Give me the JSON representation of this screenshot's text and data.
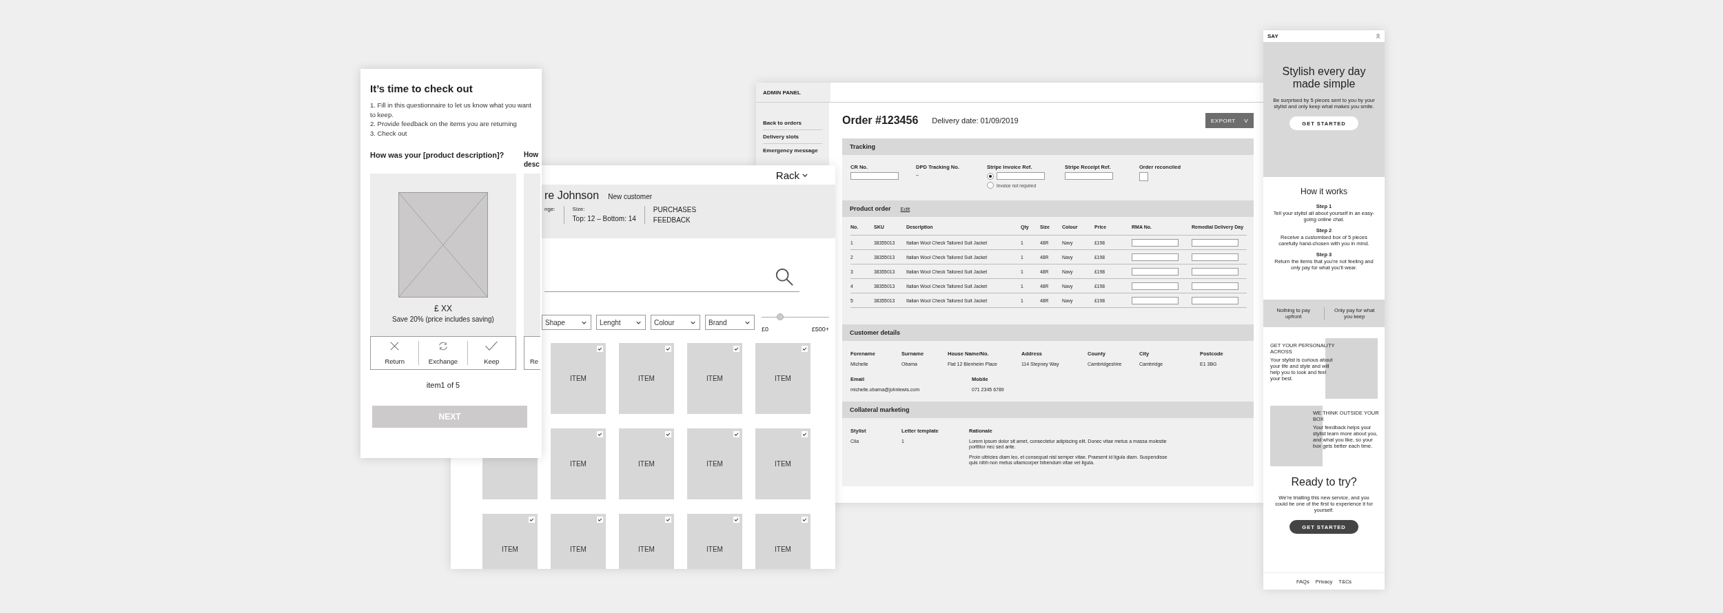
{
  "checkout_screen": {
    "title": "It’s time to check out",
    "steps": [
      "1. Fill in this questionnaire to let us know what you want to keep.",
      "2. Provide feedback on the items you are returning",
      "3. Check out"
    ],
    "questions": [
      {
        "heading": "How was your [product description]?",
        "price": "£ XX",
        "saving": "Save 20% (price includes saving)",
        "actions": [
          {
            "kind": "return",
            "label": "Return"
          },
          {
            "kind": "exchange",
            "label": "Exchange"
          },
          {
            "kind": "keep",
            "label": "Keep"
          }
        ]
      },
      {
        "heading": "How desc",
        "actions": [
          {
            "kind": "return",
            "label": "Re"
          }
        ]
      }
    ],
    "pager": "item1 of 5",
    "next_button": {
      "label": "NEXT",
      "disabled": true
    }
  },
  "rack_screen": {
    "menu": "Rack",
    "customer_name": "re Johnson",
    "customer_type": "New customer",
    "range_label": "nge:",
    "size_label": "Size:",
    "size_value": "Top: 12  –  Bottom: 14",
    "links": [
      "PURCHASES",
      "FEEDBACK"
    ],
    "filters": [
      {
        "label": "Shape"
      },
      {
        "label": "Lenght"
      },
      {
        "label": "Colour"
      },
      {
        "label": "Brand"
      }
    ],
    "price_range": {
      "min": "£0",
      "max": "£500+",
      "level": 0.28
    },
    "item_rows": [
      [
        {
          "label": "ITEM",
          "checked": true
        },
        {
          "label": "ITEM",
          "checked": true
        },
        {
          "label": "ITEM",
          "checked": true
        },
        {
          "label": "ITEM",
          "checked": true
        }
      ],
      [
        {
          "label": "ITEM",
          "checked": true
        },
        {
          "label": "ITEM",
          "checked": true
        },
        {
          "label": "ITEM",
          "checked": true
        },
        {
          "label": "ITEM",
          "checked": true
        }
      ],
      [
        {
          "label": "ITEM",
          "checked": true
        },
        {
          "label": "ITEM",
          "checked": true
        },
        {
          "label": "ITEM",
          "checked": true
        },
        {
          "label": "ITEM",
          "checked": true
        },
        {
          "label": "ITEM",
          "checked": true
        }
      ]
    ]
  },
  "admin_screen": {
    "brand": "ADMIN PANEL",
    "nav": [
      {
        "label": "Back to orders"
      },
      {
        "label": "Delivery slots"
      },
      {
        "label": "Emergency message"
      }
    ],
    "order_title": "Order #123456",
    "delivery_date": "Delivery date: 01/09/2019",
    "export_button": {
      "label": "EXPORT",
      "caret": "V"
    },
    "tracking": {
      "title": "Tracking",
      "cr_label": "CR No.",
      "dpd_label": "DPD Tracking No.",
      "dpd_value": "–",
      "invoice_label": "Stripe Invoice Ref.",
      "invoice_options": [
        {
          "kind": "input",
          "selected": true
        },
        {
          "kind": "text",
          "label": "Invoice not required",
          "selected": false
        }
      ],
      "receipt_label": "Stripe Receipt Ref.",
      "reconciled_label": "Order reconciled",
      "reconciled": false
    },
    "product_order": {
      "title": "Product order",
      "edit_link": "Edit",
      "columns": [
        "No.",
        "SKU",
        "Description",
        "Qty",
        "Size",
        "Colour",
        "Price",
        "RMA No.",
        "Remedial Delivery Day"
      ],
      "rows": [
        [
          "1",
          "38355013",
          "Italian Wool Check Tailored Suit Jacket",
          "1",
          "48R",
          "Navy",
          "£198"
        ],
        [
          "2",
          "38355013",
          "Italian Wool Check Tailored Suit Jacket",
          "1",
          "48R",
          "Navy",
          "£198"
        ],
        [
          "3",
          "38355013",
          "Italian Wool Check Tailored Suit Jacket",
          "1",
          "48R",
          "Navy",
          "£198"
        ],
        [
          "4",
          "38355013",
          "Italian Wool Check Tailored Suit Jacket",
          "1",
          "48R",
          "Navy",
          "£198"
        ],
        [
          "5",
          "38355013",
          "Italian Wool Check Tailored Suit Jacket",
          "1",
          "48R",
          "Navy",
          "£198"
        ]
      ]
    },
    "customer": {
      "title": "Customer details",
      "fields": [
        {
          "label": "Forename",
          "value": "Michelle"
        },
        {
          "label": "Surname",
          "value": "Obama"
        },
        {
          "label": "House Name/No.",
          "value": "Flat 12 Blenheim Place"
        },
        {
          "label": "Address",
          "value": "114 Stepney Way"
        },
        {
          "label": "County",
          "value": "Cambridgeshire"
        },
        {
          "label": "City",
          "value": "Cambridge"
        },
        {
          "label": "Postcode",
          "value": "E1 3BG"
        }
      ],
      "contacts": [
        {
          "label": "Email",
          "value": "michelle.obama@johnlewis.com"
        },
        {
          "label": "Mobile",
          "value": "071 2345 6789"
        }
      ]
    },
    "marketing": {
      "title": "Collateral marketing",
      "stylist_label": "Stylist",
      "stylist": "Cila",
      "template_label": "Letter template",
      "template": "1",
      "rationale_label": "Rationale",
      "rationale": [
        "Lorem ipsum dolor sit amet, consectetur adipiscing elit. Donec vitae metus a massa molestie porttitor nec sed ante.",
        "Proin ultricies diam leo, et consequat nisl semper vitae. Praesent id ligula diam. Suspendisse quis nibh non metus ullamcorper bibendum vitae vel ligula."
      ]
    }
  },
  "mobile_screen": {
    "logo": "SAY",
    "hero_title": "Stylish every day made simple",
    "hero_text": "Be surprised by 5 pieces sent to you by your stylist and only keep what makes you smile.",
    "hero_button": "GET STARTED",
    "how_title": "How it works",
    "steps": [
      {
        "title": "Step 1",
        "text": "Tell your stylist all about yourself in an easy-going online chat."
      },
      {
        "title": "Step 2",
        "text": "Receive a customised box of 5 pieces carefully hand-chosen with you in mind."
      },
      {
        "title": "Step 3",
        "text": "Return the items that you’re not feeling and only pay for what you’ll wear."
      }
    ],
    "perks": [
      "Nothing to pay upfront",
      "Only pay for what you keep"
    ],
    "features": [
      {
        "kind": "image_right",
        "title": "GET YOUR PERSONALITY ACROSS",
        "text": "Your stylist is curious about your life and style and will help you to look and feel your best."
      },
      {
        "kind": "image_left",
        "title": "WE THINK OUTSIDE YOUR BOX",
        "text": "Your feedback helps your stylist learn more about you, and what you like, so your box gets better each time."
      }
    ],
    "ready_title": "Ready to try?",
    "ready_text": "We’re trialling this new service, and you could be one of the first to experience it for yourself.",
    "ready_button": "GET STARTED",
    "footer_links": [
      "FAQs",
      "Privacy",
      "T&Cs"
    ]
  }
}
